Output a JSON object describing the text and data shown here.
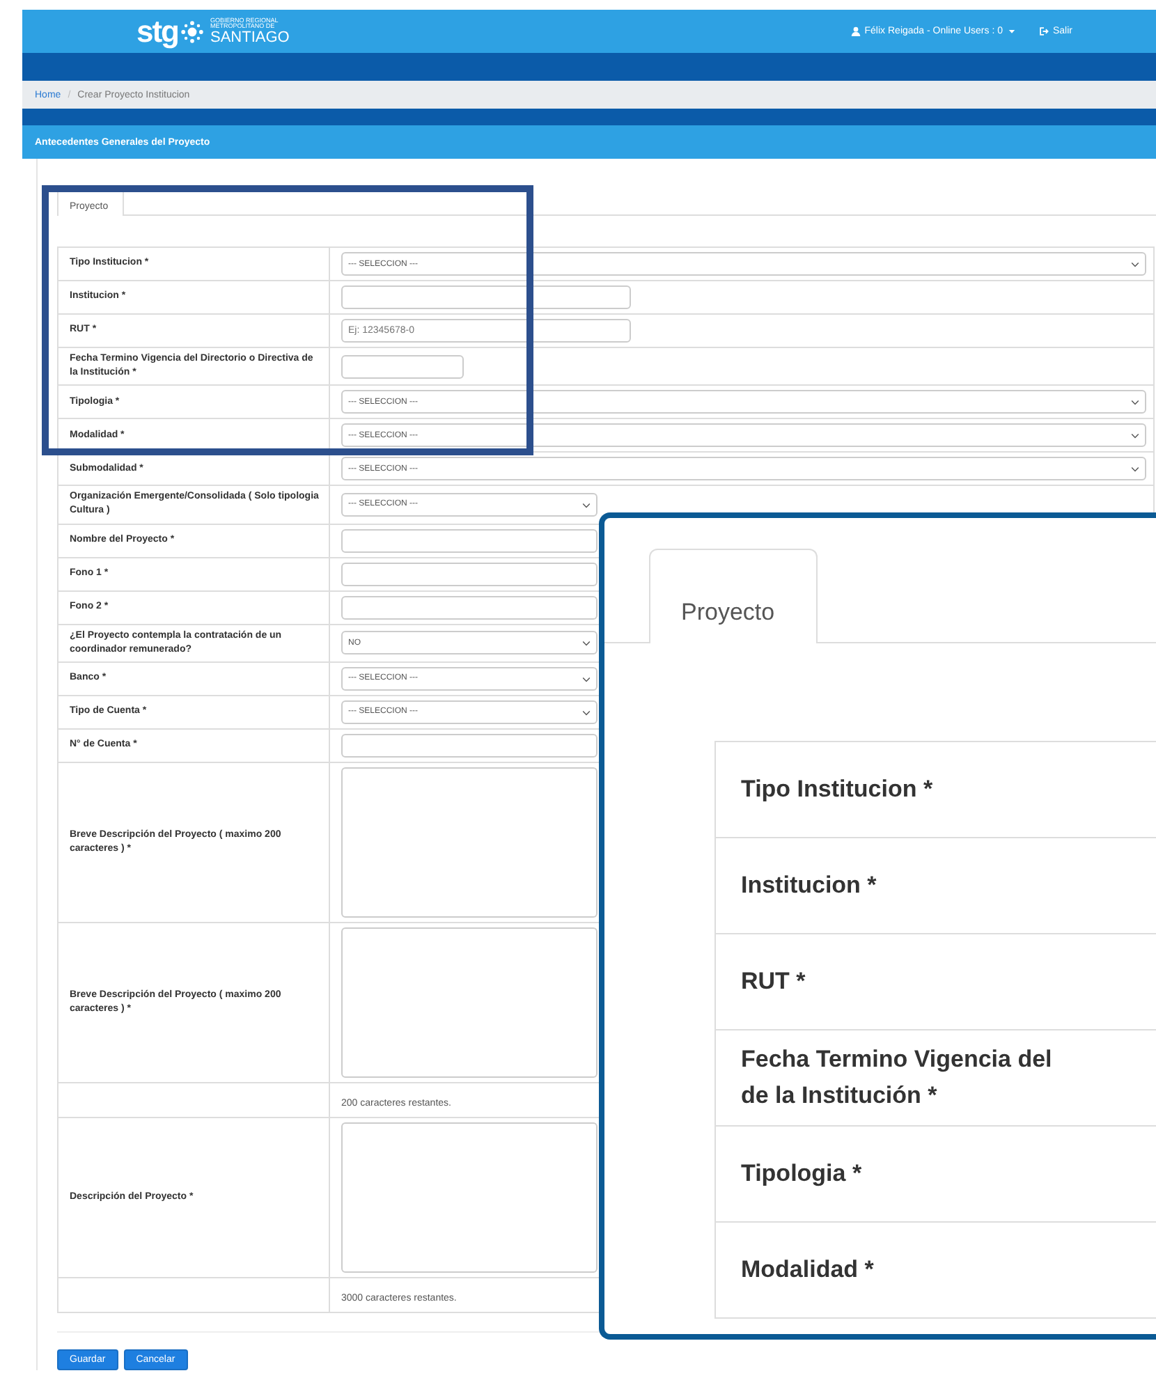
{
  "header": {
    "logo": {
      "mark": "stg",
      "lines": [
        "GOBIERNO REGIONAL",
        "METROPOLITANO DE",
        "SANTIAGO"
      ]
    },
    "user_menu": "Félix Reigada - Online Users : 0",
    "logout": "Salir"
  },
  "breadcrumb": [
    {
      "label": "Home",
      "kind": "link"
    },
    {
      "label": "/",
      "kind": "separator"
    },
    {
      "label": "Crear Proyecto Institucion",
      "kind": "current"
    }
  ],
  "panel_title": "Antecedentes Generales del Proyecto",
  "tabs": [
    {
      "label": "Proyecto",
      "selected": true
    }
  ],
  "form_rows": [
    {
      "label": "Tipo Institucion *",
      "kind": "select",
      "value": "--- SELECCION ---"
    },
    {
      "label": "Institucion *",
      "kind": "text"
    },
    {
      "label": "RUT *",
      "kind": "text",
      "placeholder": "Ej: 12345678-0"
    },
    {
      "label": "Fecha Termino Vigencia del Directorio o Directiva de la Institución *",
      "kind": "date"
    },
    {
      "label": "Tipologia *",
      "kind": "select",
      "value": "--- SELECCION ---"
    },
    {
      "label": "Modalidad *",
      "kind": "select",
      "value": "--- SELECCION ---"
    },
    {
      "label": "Submodalidad *",
      "kind": "select",
      "value": "--- SELECCION ---"
    },
    {
      "label": "Organización Emergente/Consolidada ( Solo tipologia Cultura )",
      "kind": "select",
      "value": "--- SELECCION ---"
    },
    {
      "label": "Nombre del Proyecto *",
      "kind": "input"
    },
    {
      "label": "Fono 1 *",
      "kind": "input"
    },
    {
      "label": "Fono 2 *",
      "kind": "input"
    },
    {
      "label": "¿El Proyecto contempla la contratación de un coordinador remunerado?",
      "kind": "select",
      "value": "NO"
    },
    {
      "label": "Banco *",
      "kind": "select",
      "value": "--- SELECCION ---"
    },
    {
      "label": "Tipo de Cuenta *",
      "kind": "select",
      "value": "--- SELECCION ---"
    },
    {
      "label": "N° de Cuenta *",
      "kind": "input"
    },
    {
      "label": "Breve Descripción del Proyecto ( maximo 200 caracteres ) *",
      "kind": "textarea"
    },
    {
      "label": "Breve Descripción del Proyecto ( maximo 200 caracteres ) *",
      "kind": "textarea"
    },
    {
      "kind": "counter",
      "value": "200 caracteres restantes."
    },
    {
      "label": "Descripción del Proyecto *",
      "kind": "textarea"
    },
    {
      "kind": "counter",
      "value": "3000 caracteres restantes."
    }
  ],
  "buttons": [
    {
      "label": "Guardar"
    },
    {
      "label": "Cancelar"
    }
  ],
  "zoom_inset": {
    "tabs": [
      {
        "label": "Proyecto",
        "selected": true
      }
    ],
    "rows": [
      "Tipo Institucion *",
      "Institucion *",
      "RUT *",
      "Fecha Termino Vigencia del\nde la Institución *",
      "Tipologia *",
      "Modalidad *"
    ]
  }
}
